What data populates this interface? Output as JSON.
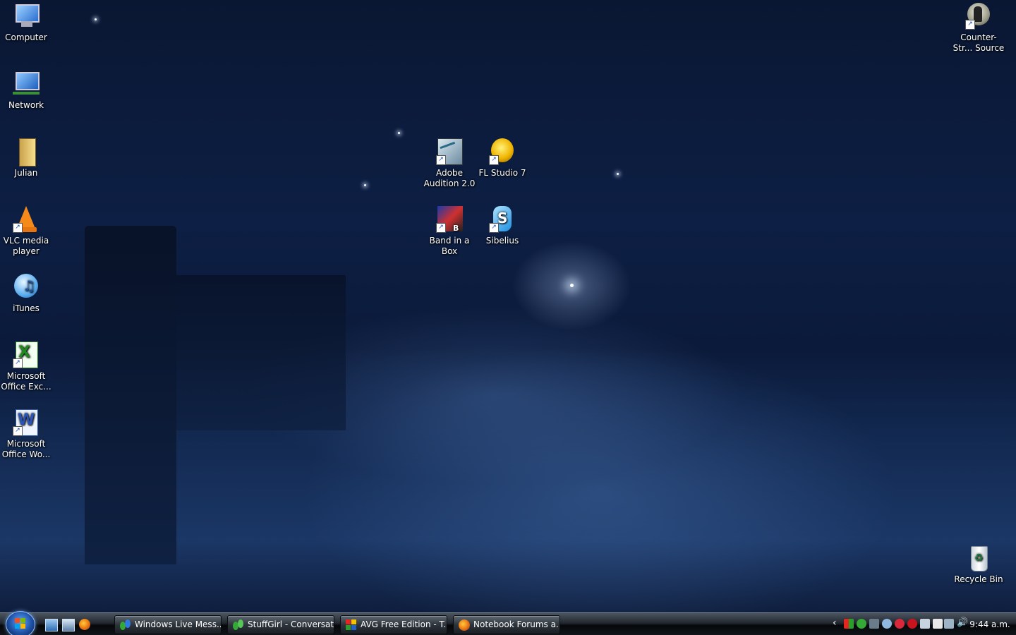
{
  "desktop": {
    "icons_left": [
      {
        "label": "Computer",
        "name": "computer-icon"
      },
      {
        "label": "Network",
        "name": "network-icon"
      },
      {
        "label": "Julian",
        "name": "user-folder-icon"
      },
      {
        "label": "VLC media player",
        "name": "vlc-icon"
      },
      {
        "label": "iTunes",
        "name": "itunes-icon"
      },
      {
        "label": "Microsoft Office Exc...",
        "name": "excel-icon"
      },
      {
        "label": "Microsoft Office Wo...",
        "name": "word-icon"
      }
    ],
    "icons_center": [
      {
        "label": "Adobe Audition 2.0",
        "name": "adobe-audition-icon"
      },
      {
        "label": "FL Studio 7",
        "name": "fl-studio-icon"
      },
      {
        "label": "Band in a Box",
        "name": "band-in-a-box-icon"
      },
      {
        "label": "Sibelius",
        "name": "sibelius-icon"
      }
    ],
    "counter_strike": {
      "label": "Counter-Str... Source",
      "name": "counter-strike-icon"
    },
    "recycle_bin": {
      "label": "Recycle Bin",
      "name": "recycle-bin-icon"
    }
  },
  "taskbar": {
    "start": "windows-start-orb",
    "quick_launch": [
      "show-desktop-icon",
      "switch-windows-icon",
      "firefox-icon"
    ],
    "tasks": [
      {
        "label": "Windows Live Mess...",
        "icon": "messenger-icon"
      },
      {
        "label": "StuffGirl - Conversat...",
        "icon": "messenger-conversation-icon"
      },
      {
        "label": "AVG Free Edition - T...",
        "icon": "avg-icon"
      },
      {
        "label": "Notebook Forums a...",
        "icon": "firefox-icon"
      }
    ],
    "tray_icons": [
      "show-hidden-icons-chevron",
      "tray-app-icon",
      "tray-messenger-icon",
      "tray-network-icon",
      "tray-avg-icon",
      "tray-alert-icon",
      "tray-flash-icon",
      "tray-display-icon",
      "tray-power-icon",
      "tray-network-status-icon",
      "volume-icon"
    ],
    "clock": "9:44 a.m."
  }
}
